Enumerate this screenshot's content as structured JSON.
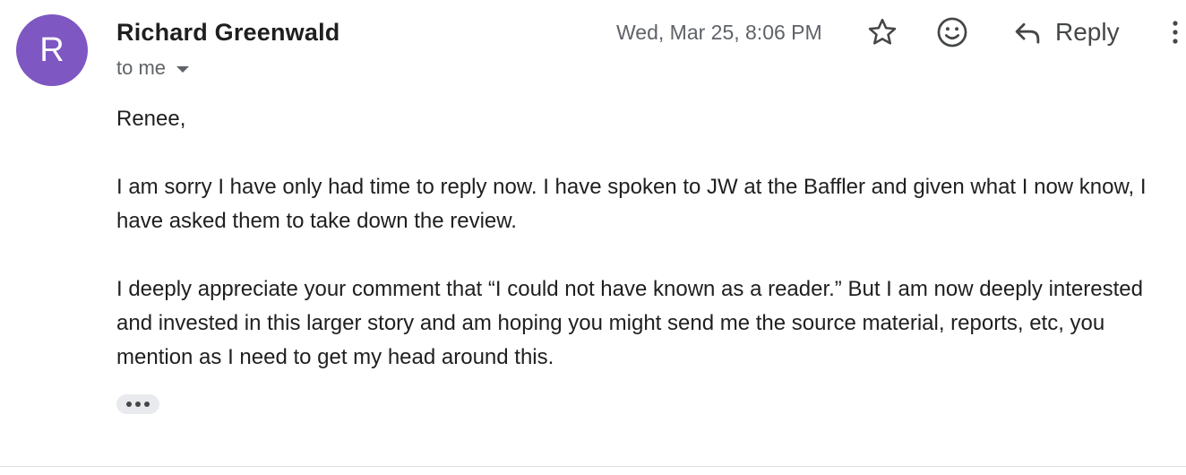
{
  "header": {
    "avatar_letter": "R",
    "avatar_color": "#7e57c2",
    "sender_name": "Richard Greenwald",
    "recipients_label": "to me",
    "timestamp": "Wed, Mar 25, 8:06 PM",
    "reply_label": "Reply",
    "icons": {
      "star": "star-icon",
      "emoji": "emoji-reaction-icon",
      "reply": "reply-arrow-icon",
      "more": "more-vertical-icon",
      "recipients_dropdown": "chevron-down-icon"
    }
  },
  "message": {
    "paragraphs": [
      "Renee,",
      "I am sorry I have only had time to reply now. I have spoken to JW at the Baffler and given what I now know, I have asked them to take down the review.",
      "I deeply appreciate your comment that “I could not have known as a reader.” But I am now deeply interested and invested in this larger story and am hoping you might send me the source material, reports, etc, you mention as I need to get my head around this."
    ]
  },
  "trimmed_content": {
    "icon": "show-trimmed-content-icon"
  }
}
